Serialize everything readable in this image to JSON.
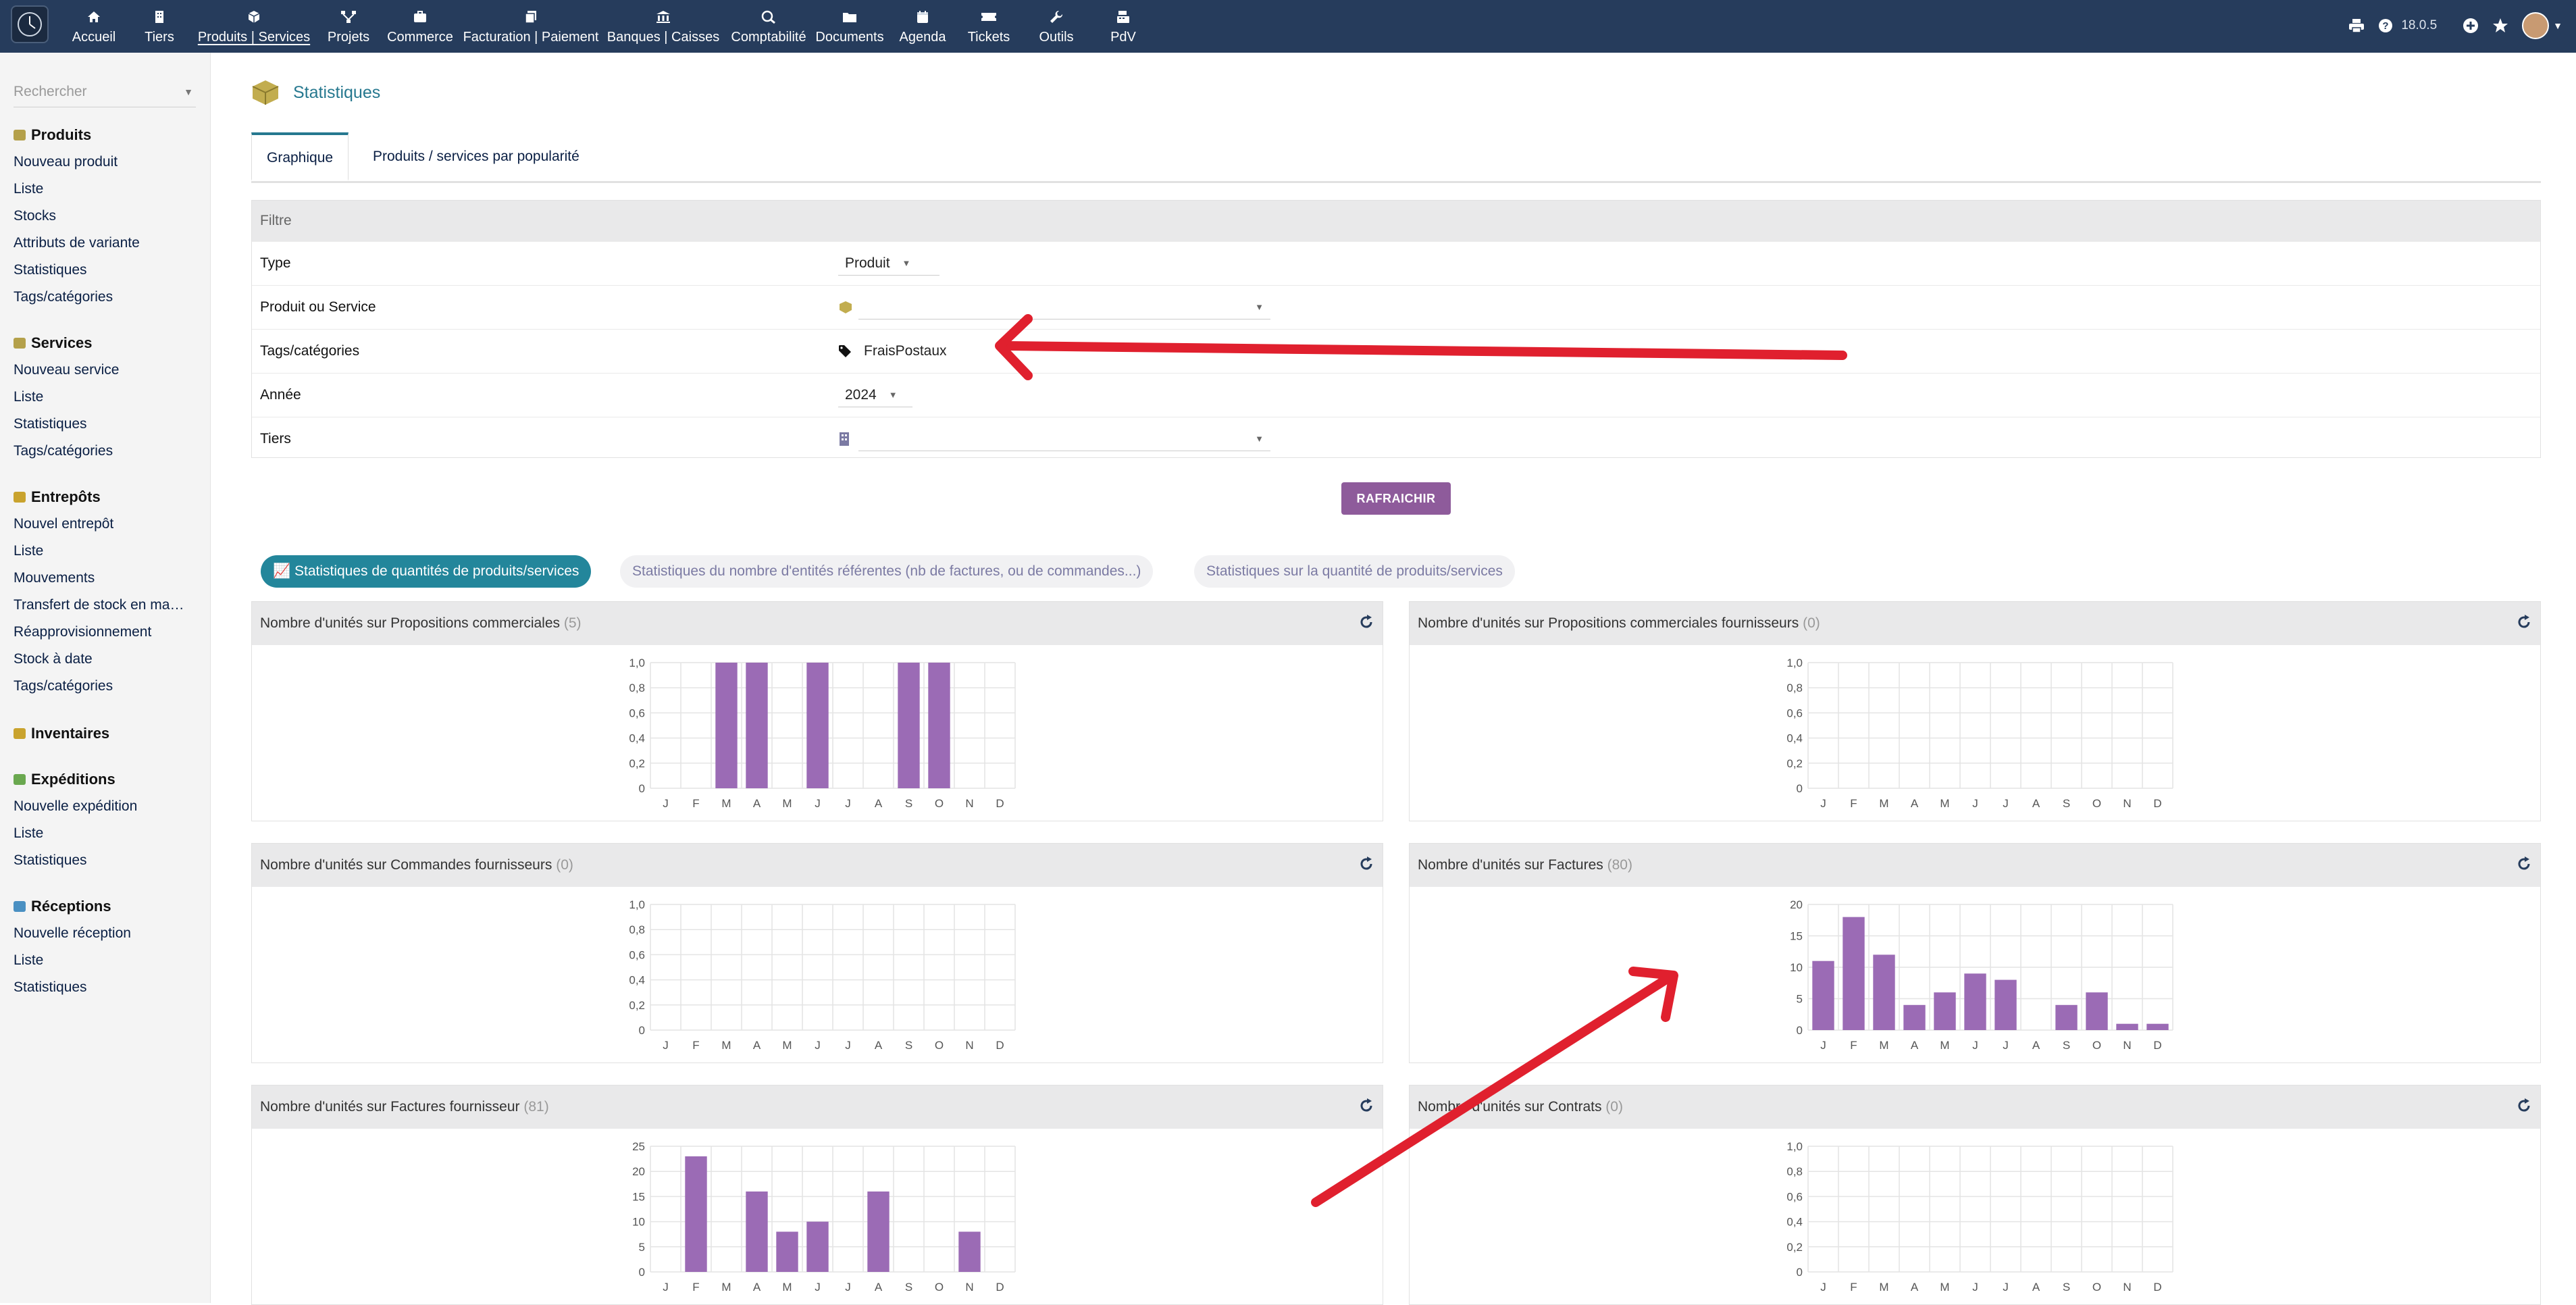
{
  "topbar": {
    "menu": [
      {
        "label": "Accueil",
        "icon": "home-icon"
      },
      {
        "label": "Tiers",
        "icon": "building-icon"
      },
      {
        "label": "Produits | Services",
        "icon": "cube-icon",
        "active": true
      },
      {
        "label": "Projets",
        "icon": "sitemap-icon"
      },
      {
        "label": "Commerce",
        "icon": "briefcase-icon"
      },
      {
        "label": "Facturation | Paiement",
        "icon": "invoice-icon"
      },
      {
        "label": "Banques | Caisses",
        "icon": "bank-icon"
      },
      {
        "label": "Comptabilité",
        "icon": "search-dollar-icon"
      },
      {
        "label": "Documents",
        "icon": "folder-icon"
      },
      {
        "label": "Agenda",
        "icon": "calendar-icon"
      },
      {
        "label": "Tickets",
        "icon": "ticket-icon"
      },
      {
        "label": "Outils",
        "icon": "wrench-icon"
      },
      {
        "label": "PdV",
        "icon": "cash-register-icon"
      }
    ],
    "version": "18.0.5"
  },
  "sidebar": {
    "search_placeholder": "Rechercher",
    "sections": [
      {
        "title": "Produits",
        "color": "#b4a04a",
        "items": [
          "Nouveau produit",
          "Liste",
          "Stocks",
          "Attributs de variante",
          "Statistiques",
          "Tags/catégories"
        ]
      },
      {
        "title": "Services",
        "color": "#b4a04a",
        "items": [
          "Nouveau service",
          "Liste",
          "Statistiques",
          "Tags/catégories"
        ]
      },
      {
        "title": "Entrepôts",
        "color": "#c9a32e",
        "items": [
          "Nouvel entrepôt",
          "Liste",
          "Mouvements",
          "Transfert de stock en ma…",
          "Réapprovisionnement",
          "Stock à date",
          "Tags/catégories"
        ]
      },
      {
        "title": "Inventaires",
        "color": "#c9a32e",
        "items": []
      },
      {
        "title": "Expéditions",
        "color": "#6aa84f",
        "items": [
          "Nouvelle expédition",
          "Liste",
          "Statistiques"
        ]
      },
      {
        "title": "Réceptions",
        "color": "#4a90c2",
        "items": [
          "Nouvelle réception",
          "Liste",
          "Statistiques"
        ]
      }
    ]
  },
  "page": {
    "title": "Statistiques",
    "tabs": [
      "Graphique",
      "Produits / services par popularité"
    ],
    "filter": {
      "header": "Filtre",
      "rows": [
        {
          "label": "Type",
          "value": "Produit"
        },
        {
          "label": "Produit ou Service",
          "value": ""
        },
        {
          "label": "Tags/catégories",
          "value": "FraisPostaux"
        },
        {
          "label": "Année",
          "value": "2024"
        },
        {
          "label": "Tiers",
          "value": ""
        }
      ]
    },
    "refresh_label": "RAFRAICHIR",
    "stat_tabs": [
      "Statistiques de quantités de produits/services",
      "Statistiques du nombre d'entités référentes (nb de factures, ou de commandes...)",
      "Statistiques sur la quantité de produits/services"
    ]
  },
  "chart_data": [
    {
      "type": "bar",
      "title": "Nombre d'unités sur Propositions commerciales",
      "count": "(5)",
      "categories": [
        "J",
        "F",
        "M",
        "A",
        "M",
        "J",
        "J",
        "A",
        "S",
        "O",
        "N",
        "D"
      ],
      "values": [
        0,
        0,
        1,
        1,
        0,
        1,
        0,
        0,
        1,
        1,
        0,
        0
      ],
      "ylim": [
        0,
        1
      ],
      "yticks": [
        "1,0",
        "0,8",
        "0,6",
        "0,4",
        "0,2",
        "0"
      ],
      "color": "#9b6bb5"
    },
    {
      "type": "bar",
      "title": "Nombre d'unités sur Propositions commerciales fournisseurs",
      "count": "(0)",
      "categories": [
        "J",
        "F",
        "M",
        "A",
        "M",
        "J",
        "J",
        "A",
        "S",
        "O",
        "N",
        "D"
      ],
      "values": [
        0,
        0,
        0,
        0,
        0,
        0,
        0,
        0,
        0,
        0,
        0,
        0
      ],
      "ylim": [
        0,
        1
      ],
      "yticks": [
        "1,0",
        "0,8",
        "0,6",
        "0,4",
        "0,2",
        "0"
      ],
      "color": "#9b6bb5"
    },
    {
      "type": "bar",
      "title": "Nombre d'unités sur Commandes fournisseurs",
      "count": "(0)",
      "categories": [
        "J",
        "F",
        "M",
        "A",
        "M",
        "J",
        "J",
        "A",
        "S",
        "O",
        "N",
        "D"
      ],
      "values": [
        0,
        0,
        0,
        0,
        0,
        0,
        0,
        0,
        0,
        0,
        0,
        0
      ],
      "ylim": [
        0,
        1
      ],
      "yticks": [
        "1,0",
        "0,8",
        "0,6",
        "0,4",
        "0,2",
        "0"
      ],
      "color": "#9b6bb5"
    },
    {
      "type": "bar",
      "title": "Nombre d'unités sur Factures",
      "count": "(80)",
      "categories": [
        "J",
        "F",
        "M",
        "A",
        "M",
        "J",
        "J",
        "A",
        "S",
        "O",
        "N",
        "D"
      ],
      "values": [
        11,
        18,
        12,
        4,
        6,
        9,
        8,
        0,
        4,
        6,
        1,
        1
      ],
      "ylim": [
        0,
        20
      ],
      "yticks": [
        "20",
        "15",
        "10",
        "5",
        "0"
      ],
      "color": "#9b6bb5"
    },
    {
      "type": "bar",
      "title": "Nombre d'unités sur Factures fournisseur",
      "count": "(81)",
      "categories": [
        "J",
        "F",
        "M",
        "A",
        "M",
        "J",
        "J",
        "A",
        "S",
        "O",
        "N",
        "D"
      ],
      "values": [
        0,
        23,
        0,
        16,
        8,
        10,
        0,
        16,
        0,
        0,
        8,
        0
      ],
      "ylim": [
        0,
        25
      ],
      "yticks": [
        "25",
        "20",
        "15",
        "10",
        "5",
        "0"
      ],
      "color": "#9b6bb5"
    },
    {
      "type": "bar",
      "title": "Nombre d'unités sur Contrats",
      "count": "(0)",
      "categories": [
        "J",
        "F",
        "M",
        "A",
        "M",
        "J",
        "J",
        "A",
        "S",
        "O",
        "N",
        "D"
      ],
      "values": [
        0,
        0,
        0,
        0,
        0,
        0,
        0,
        0,
        0,
        0,
        0,
        0
      ],
      "ylim": [
        0,
        1
      ],
      "yticks": [
        "1,0",
        "0,8",
        "0,6",
        "0,4",
        "0,2",
        "0"
      ],
      "color": "#9b6bb5"
    }
  ]
}
